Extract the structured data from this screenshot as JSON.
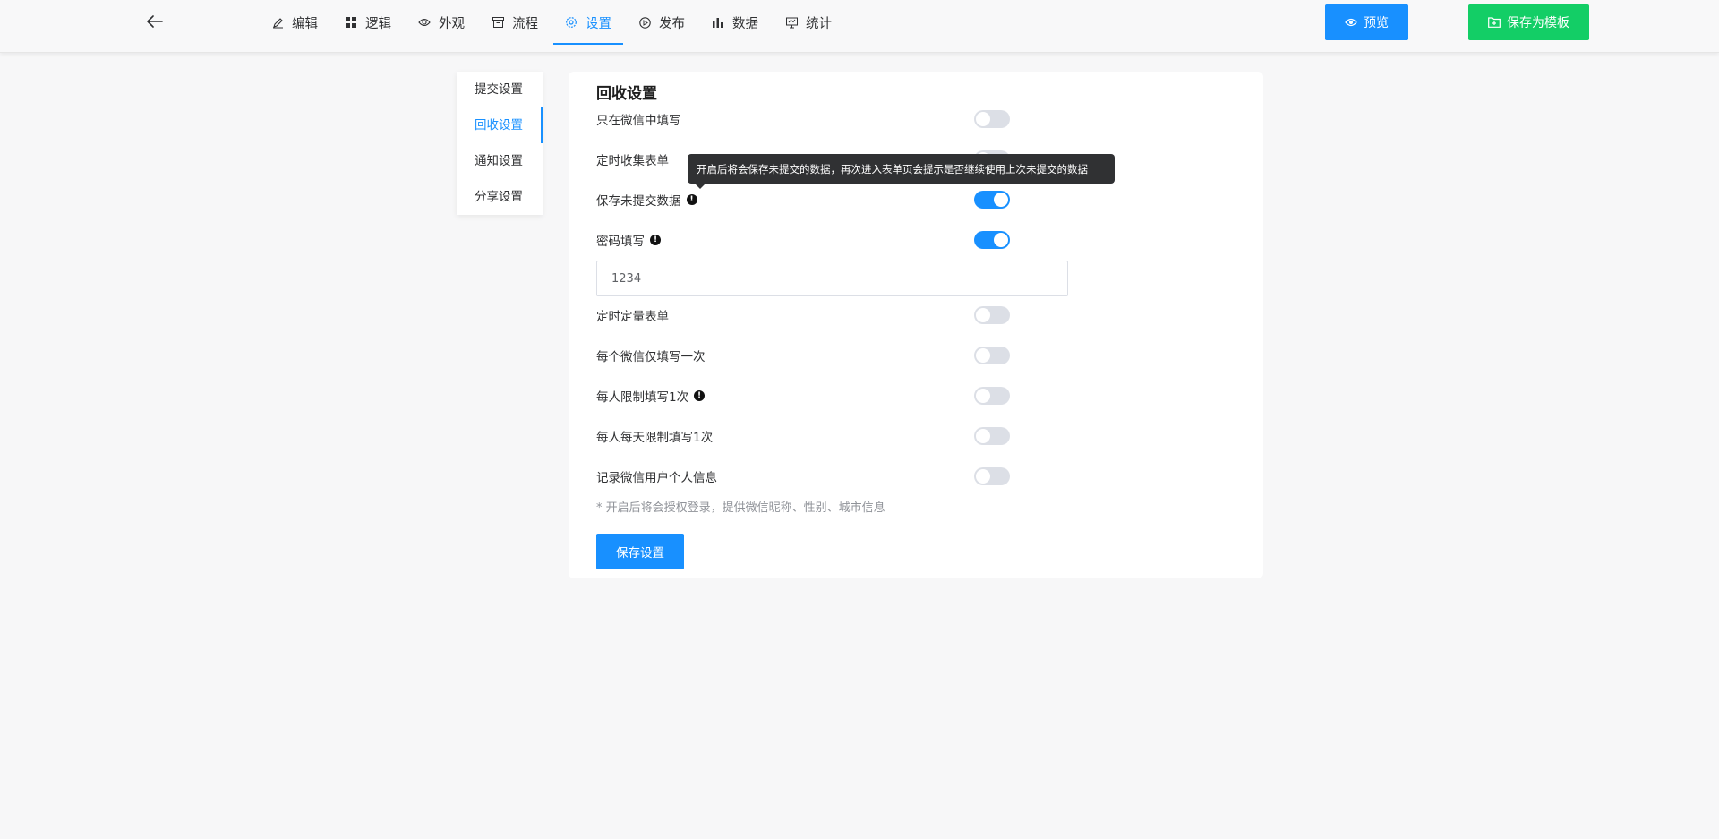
{
  "topbar": {
    "back_icon": "arrow-left-icon",
    "nav": [
      {
        "label": "编辑",
        "icon": "edit-icon",
        "active": false
      },
      {
        "label": "逻辑",
        "icon": "grid-icon",
        "active": false
      },
      {
        "label": "外观",
        "icon": "eye-icon",
        "active": false
      },
      {
        "label": "流程",
        "icon": "flow-icon",
        "active": false
      },
      {
        "label": "设置",
        "icon": "gear-icon",
        "active": true
      },
      {
        "label": "发布",
        "icon": "play-circle-icon",
        "active": false
      },
      {
        "label": "数据",
        "icon": "bar-chart-icon",
        "active": false
      },
      {
        "label": "统计",
        "icon": "stats-icon",
        "active": false
      }
    ],
    "preview_label": "预览",
    "template_label": "保存为模板"
  },
  "side_menu": [
    {
      "label": "提交设置",
      "active": false
    },
    {
      "label": "回收设置",
      "active": true
    },
    {
      "label": "通知设置",
      "active": false
    },
    {
      "label": "分享设置",
      "active": false
    }
  ],
  "panel": {
    "title": "回收设置",
    "settings": [
      {
        "label": "只在微信中填写",
        "info": false,
        "on": false
      },
      {
        "label": "定时收集表单",
        "info": false,
        "on": false
      },
      {
        "label": "保存未提交数据",
        "info": true,
        "on": true
      },
      {
        "label": "密码填写",
        "info": true,
        "on": true
      },
      {
        "label": "定时定量表单",
        "info": false,
        "on": false
      },
      {
        "label": "每个微信仅填写一次",
        "info": false,
        "on": false
      },
      {
        "label": "每人限制填写1次",
        "info": true,
        "on": false
      },
      {
        "label": "每人每天限制填写1次",
        "info": false,
        "on": false
      },
      {
        "label": "记录微信用户个人信息",
        "info": false,
        "on": false
      }
    ],
    "password_value": "1234",
    "hint": "* 开启后将会授权登录，提供微信昵称、性别、城市信息",
    "save_label": "保存设置"
  },
  "tooltip": {
    "text": "开启后将会保存未提交的数据，再次进入表单页会提示是否继续使用上次未提交的数据"
  },
  "colors": {
    "primary": "#1890ff",
    "success": "#13ce66",
    "tooltip_bg": "#303133",
    "switch_off": "#dcdfe6"
  }
}
